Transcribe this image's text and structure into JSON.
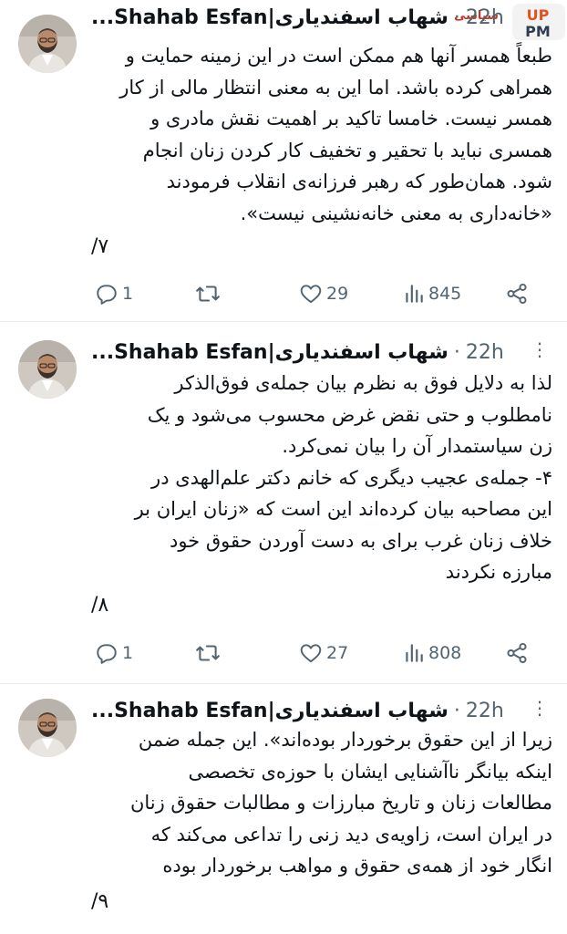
{
  "watermark": {
    "text": "سیاسی",
    "logo_text": "UPPM"
  },
  "tweets": [
    {
      "author": "شهاب اسفندیاری|Shahab Esfan...",
      "time": "22h",
      "lines": [
        "طبعاً همسر آنها هم ممکن است در این زمینه حمایت و",
        "همراهی کرده باشد. اما این به معنی انتظار مالی از کار",
        "همسر نیست. خامسا تاکید بر اهمیت نقش مادری و",
        "همسری نباید با تحقیر و تخفیف کار کردن زنان انجام",
        "شود. همان‌طور که رهبر فرزانه‌ی انقلاب فرمودند",
        "«خانه‌داری به معنی خانه‌نشینی نیست»."
      ],
      "counter": "۷/",
      "replies": "1",
      "retweets": "",
      "likes": "29",
      "views": "845"
    },
    {
      "author": "شهاب اسفندیاری|Shahab Esfan...",
      "time": "22h",
      "lines": [
        "لذا به دلایل فوق به نظرم بیان جمله‌ی فوق‌الذکر",
        "نامطلوب و حتی نقض غرض محسوب می‌شود و یک",
        "زن سیاستمدار آن را بیان نمی‌کرد.",
        "۴- جمله‌ی عجیب دیگری که خانم دکتر علم‌الهدی در",
        "این مصاحبه بیان کرده‌اند این است که «زنان ایران بر",
        "خلاف زنان غرب برای به دست آوردن حقوق خود",
        "مبارزه نکردند"
      ],
      "counter": "۸/",
      "replies": "1",
      "retweets": "",
      "likes": "27",
      "views": "808"
    },
    {
      "author": "شهاب اسفندیاری|Shahab Esfan...",
      "time": "22h",
      "lines": [
        "زیرا از این حقوق برخوردار بوده‌اند». این جمله ضمن",
        "اینکه بیانگر ناآشنایی ایشان با حوزه‌ی تخصصی",
        "مطالعات زنان و تاریخ مبارزات و مطالبات حقوق زنان",
        "در ایران است، زاویه‌ی دید زنی را تداعی می‌کند که",
        "انگار خود از همه‌ی حقوق و مواهب برخوردار بوده"
      ],
      "counter": "۹/"
    }
  ]
}
